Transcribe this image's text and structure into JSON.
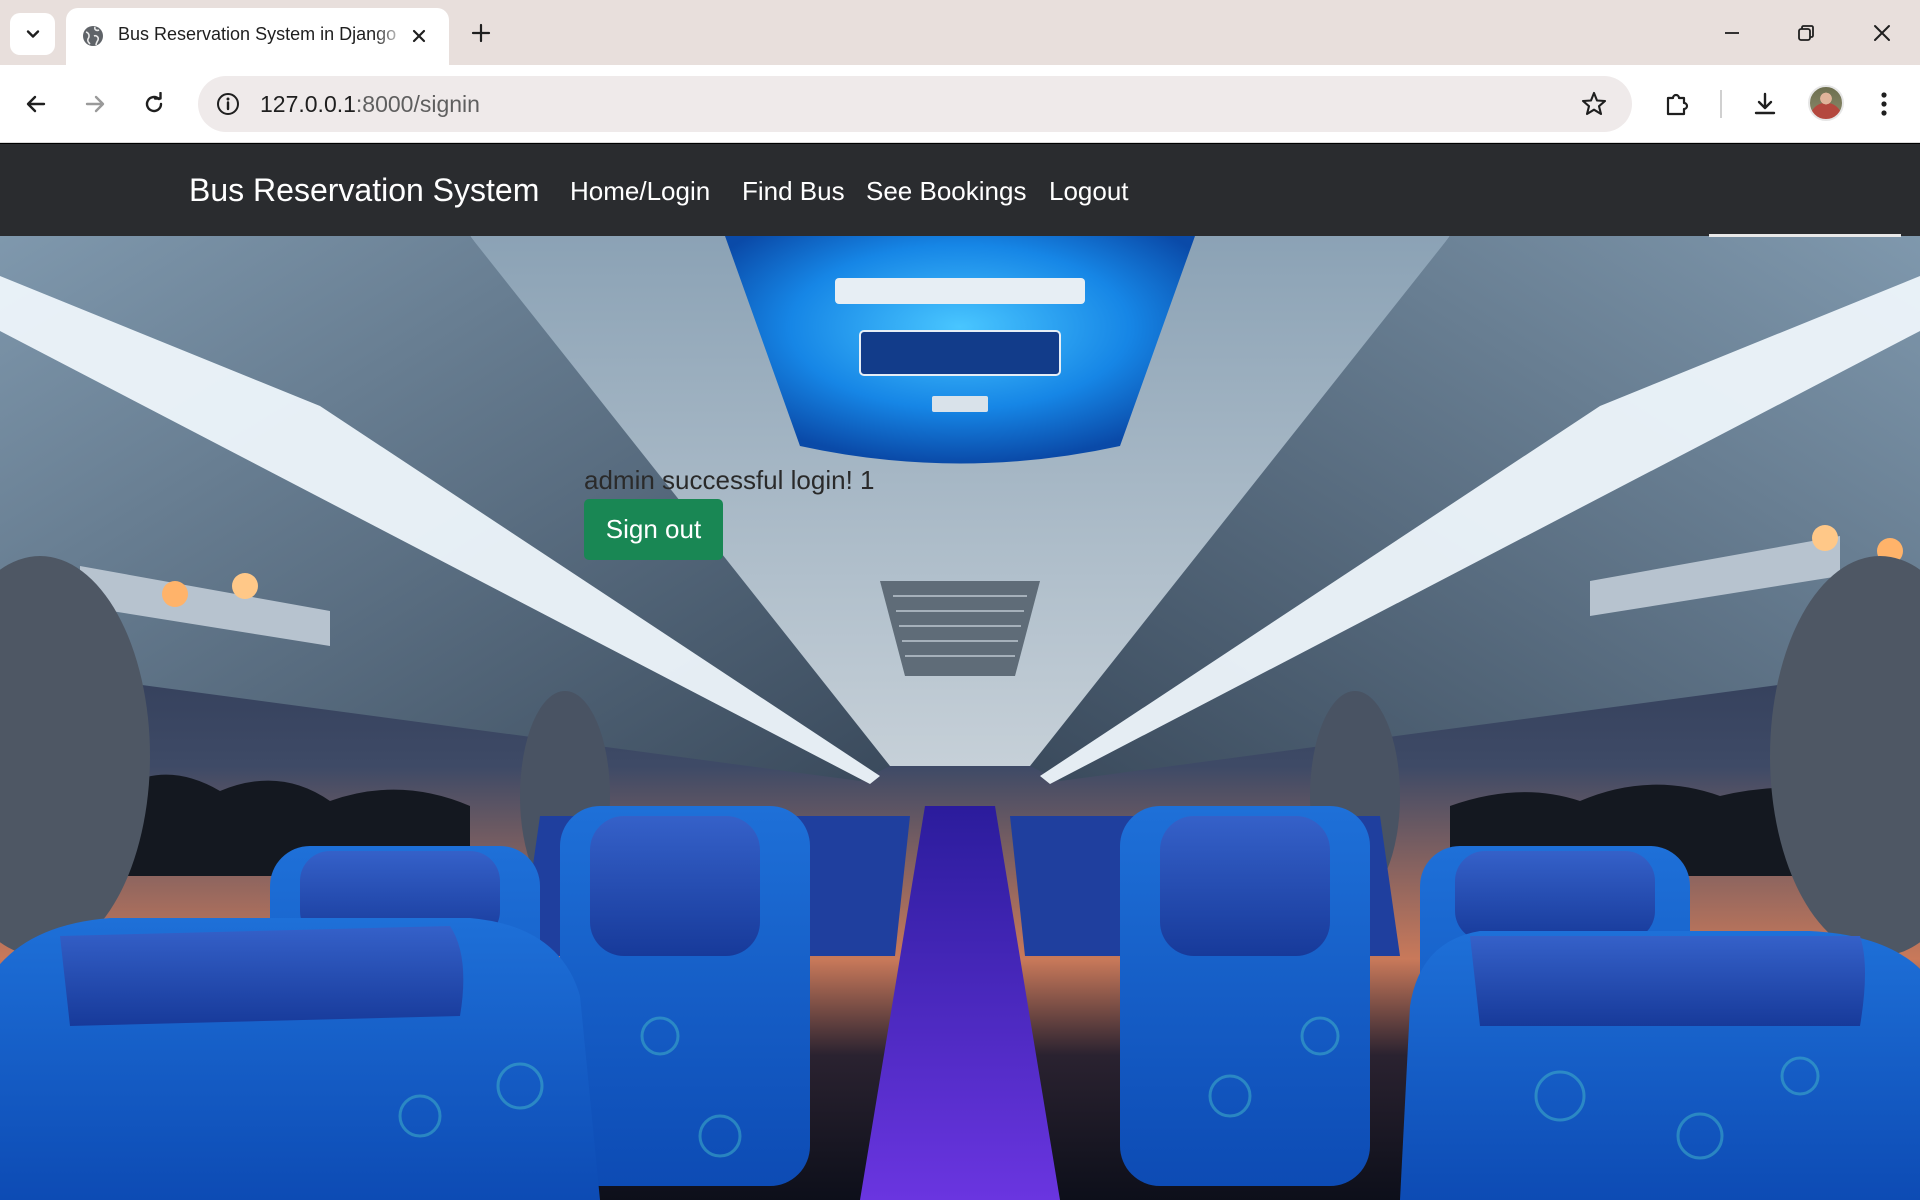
{
  "browser": {
    "tab": {
      "title": "Bus Reservation System in Django"
    },
    "address_bar": {
      "url_host": "127.0.0.1",
      "url_rest": ":8000/signin"
    }
  },
  "navbar": {
    "brand": "Bus Reservation System",
    "links": [
      "Home/Login",
      "Find Bus",
      "See Bookings",
      "Logout"
    ]
  },
  "content": {
    "message": "admin successful login! 1",
    "signout_label": "Sign out"
  },
  "colors": {
    "navbar_bg": "#2a2c2f",
    "signout_bg": "#198754",
    "tabstrip_bg": "#e8dfdc"
  },
  "icons": {
    "tab_search": "chevron-down-icon",
    "favicon": "globe-icon",
    "tab_close": "close-icon",
    "new_tab": "plus-icon",
    "back": "arrow-left-icon",
    "forward": "arrow-right-icon",
    "reload": "reload-icon",
    "site_info": "info-icon",
    "bookmark": "star-icon",
    "extensions": "puzzle-icon",
    "downloads": "download-icon",
    "menu": "kebab-menu-icon"
  }
}
